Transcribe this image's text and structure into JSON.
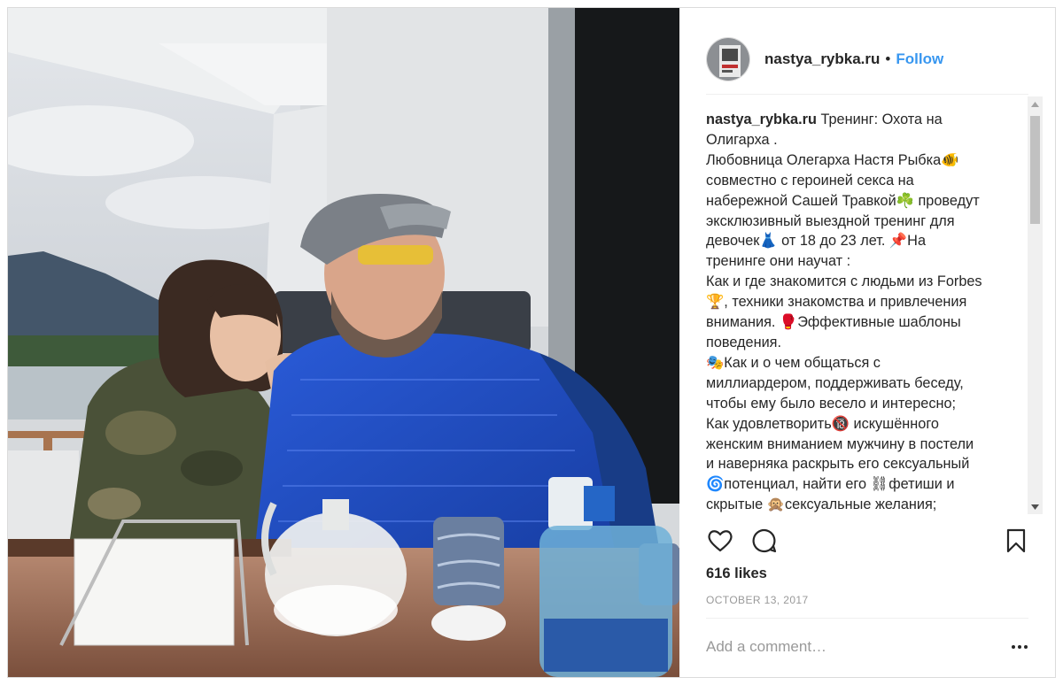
{
  "post": {
    "username": "nastya_rybka.ru",
    "separator": "•",
    "follow_label": "Follow",
    "caption_lines": [
      "Тренинг: Охота на",
      "Олигарха .",
      "Любовница Олегарха Настя Рыбка🐠",
      "совместно с героиней секса на",
      "набережной Сашей Травкой☘️ проведут",
      "эксклюзивный выездной тренинг для",
      "девочек👗 от 18 до 23 лет. 📌На",
      "тренинге они научат :",
      "Как и где знакомится с людьми из Forbes",
      "🏆, техники знакомства и привлечения",
      "внимания. 🥊Эффективные шаблоны",
      "поведения.",
      "🎭Как и о чем общаться с",
      "миллиардером, поддерживать беседу,",
      "чтобы ему было весело и интересно;",
      "Как удовлетворить🔞 искушённого",
      "женским вниманием мужчину в постели",
      "и наверняка раскрыть его сексуальный",
      "🌀потенциал, найти его ⛓фетиши и",
      "скрытые 🙊сексуальные желания;"
    ],
    "likes": "616 likes",
    "date": "OCTOBER 13, 2017",
    "comment_placeholder": "Add a comment…",
    "more_label": "•••"
  },
  "icons": {
    "like": "heart-icon",
    "comment": "comment-icon",
    "save": "bookmark-icon",
    "more": "more-options-icon"
  },
  "colors": {
    "follow": "#3897f0",
    "text": "#262626",
    "muted": "#999999",
    "border": "#dbdbdb"
  }
}
